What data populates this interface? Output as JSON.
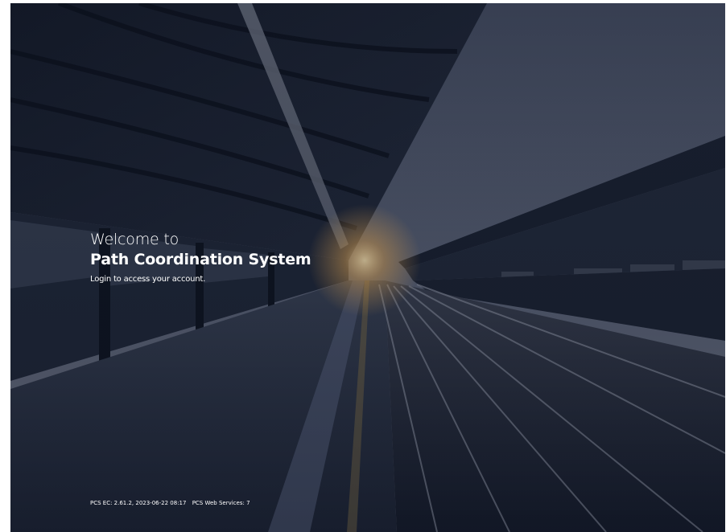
{
  "welcome": {
    "greeting": "Welcome to",
    "system_name": "Path Coordination System",
    "subtitle": "Login to access your account."
  },
  "footer": {
    "ec_version": "PCS EC: 2.61.2, 2023-06-22 08:17",
    "ws_version": "PCS Web Services: 7"
  },
  "colors": {
    "text": "#ffffff",
    "sky": "#5c6478",
    "canopy": "#101522",
    "glow": "#f2b35a"
  }
}
